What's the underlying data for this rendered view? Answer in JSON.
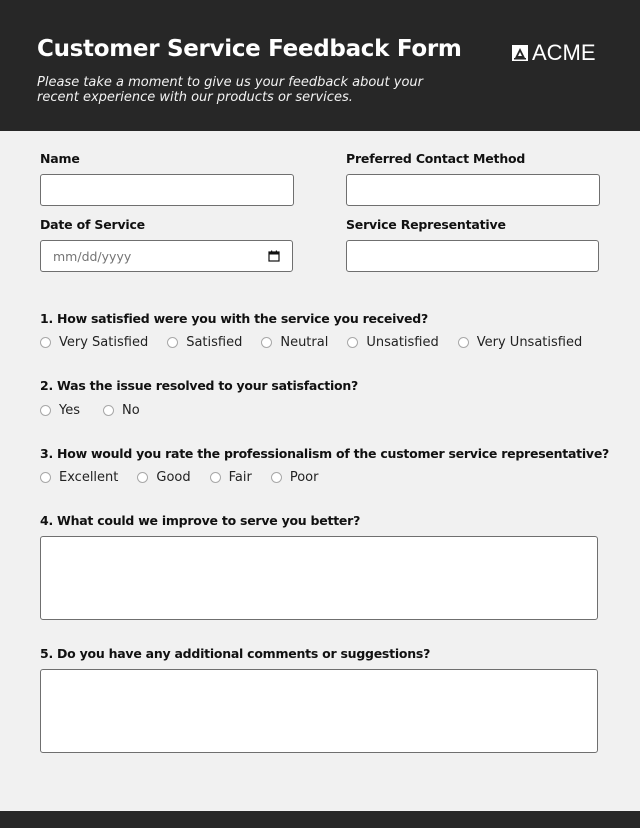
{
  "header": {
    "title": "Customer Service Feedback Form",
    "subtitle": "Please take a moment to give us your feedback about your recent experience with our products or services.",
    "logo_text": "ACME",
    "logo_icon": "acme-logo-mark-icon"
  },
  "colors": {
    "header_bg": "#272727",
    "page_bg": "#f1f1f1",
    "field_border": "#6f6f6f"
  },
  "fields": {
    "name": {
      "label": "Name",
      "value": "",
      "placeholder": ""
    },
    "contact_method": {
      "label": "Preferred Contact Method",
      "value": "",
      "placeholder": ""
    },
    "date_of_service": {
      "label": "Date of Service",
      "placeholder": "mm/dd/yyyy",
      "icon": "calendar-icon"
    },
    "representative": {
      "label": "Service Representative",
      "value": "",
      "placeholder": ""
    }
  },
  "questions": [
    {
      "text": "1. How satisfied were you with the service you received?",
      "options": [
        "Very Satisfied",
        "Satisfied",
        "Neutral",
        "Unsatisfied",
        "Very Unsatisfied"
      ]
    },
    {
      "text": "2. Was the issue resolved to your satisfaction?",
      "options": [
        "Yes",
        "No"
      ]
    },
    {
      "text": "3. How would you rate the professionalism of the customer service representative?",
      "options": [
        "Excellent",
        "Good",
        "Fair",
        "Poor"
      ]
    },
    {
      "text": "4. What could we improve to serve you better?",
      "value": ""
    },
    {
      "text": "5. Do you have any additional comments or suggestions?",
      "value": ""
    }
  ]
}
